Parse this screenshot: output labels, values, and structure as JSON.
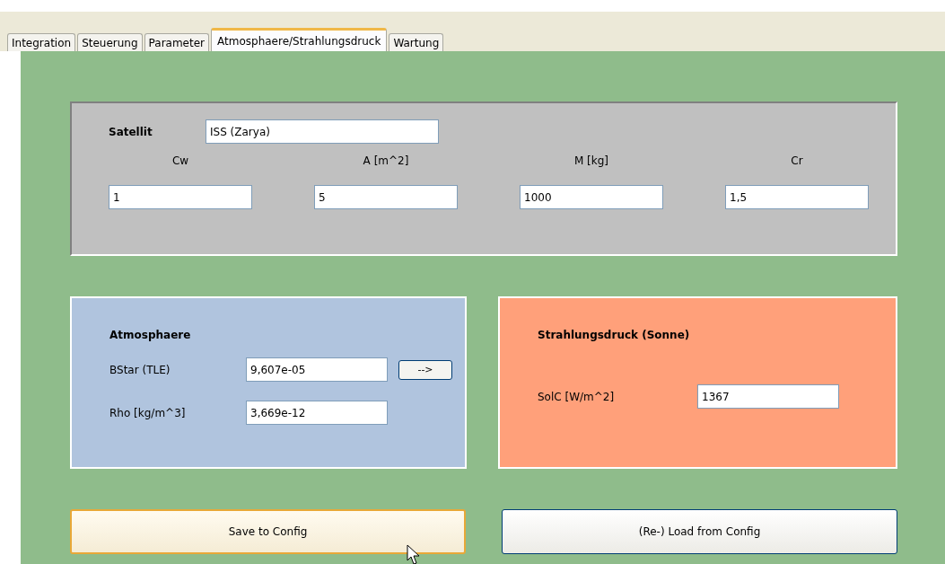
{
  "tabs": [
    {
      "label": "Integration",
      "selected": false
    },
    {
      "label": "Steuerung",
      "selected": false
    },
    {
      "label": "Parameter",
      "selected": false
    },
    {
      "label": "Atmosphaere/Strahlungsdruck",
      "selected": true
    },
    {
      "label": "Wartung",
      "selected": false
    }
  ],
  "satellite": {
    "label": "Satellit",
    "value": "ISS (Zarya)",
    "fields": [
      {
        "label": "Cw",
        "value": "1"
      },
      {
        "label": "A [m^2]",
        "value": "5"
      },
      {
        "label": "M [kg]",
        "value": "1000"
      },
      {
        "label": "Cr",
        "value": "1,5"
      }
    ]
  },
  "atmosphere": {
    "title": "Atmosphaere",
    "rows": [
      {
        "label": "BStar (TLE)",
        "value": "9,607e-05",
        "button": "-->"
      },
      {
        "label": "Rho [kg/m^3]",
        "value": "3,669e-12"
      }
    ]
  },
  "radiation": {
    "title": "Strahlungsdruck (Sonne)",
    "rows": [
      {
        "label": "SolC [W/m^2]",
        "value": "1367"
      }
    ]
  },
  "buttons": [
    {
      "label": "Save to Config",
      "hovered": true
    },
    {
      "label": "(Re-) Load from Config",
      "hovered": false
    }
  ]
}
